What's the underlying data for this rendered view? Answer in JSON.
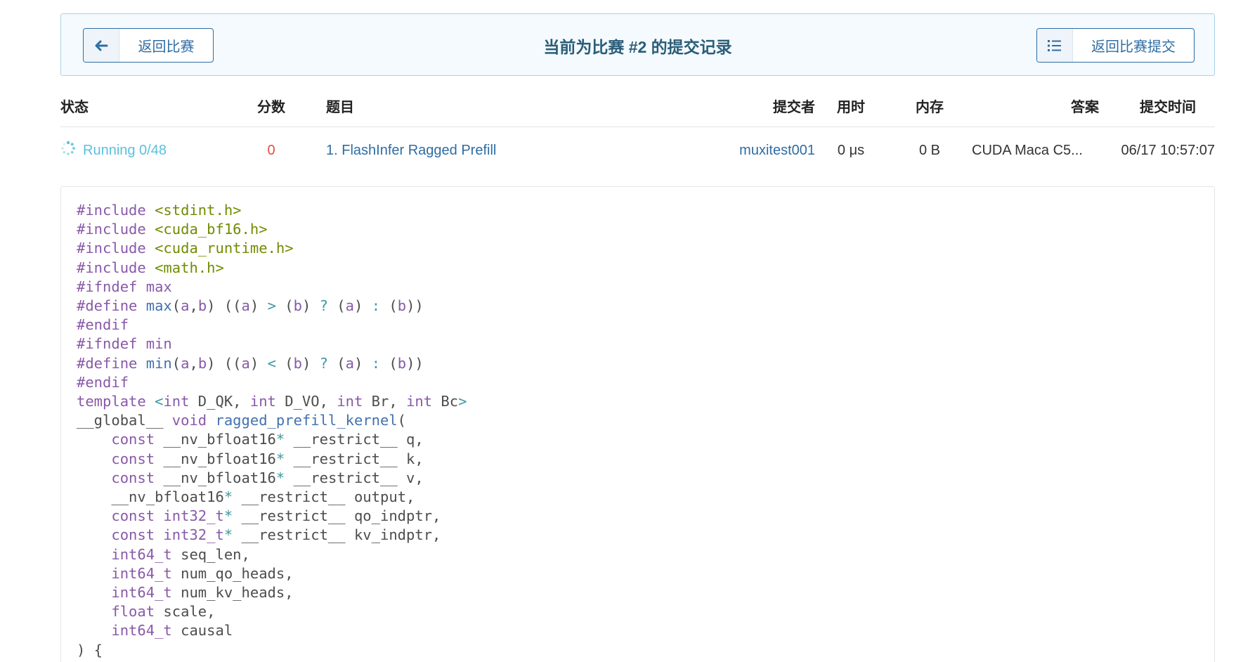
{
  "header": {
    "back_label": "返回比赛",
    "title": "当前为比赛 #2 的提交记录",
    "submissions_label": "返回比赛提交"
  },
  "table": {
    "columns": {
      "status": "状态",
      "score": "分数",
      "problem": "题目",
      "submitter": "提交者",
      "time": "用时",
      "memory": "内存",
      "answer": "答案",
      "submit_time": "提交时间"
    },
    "row": {
      "status": "Running 0/48",
      "score": "0",
      "problem": "1. FlashInfer Ragged Prefill",
      "submitter": "muxitest001",
      "time": "0 μs",
      "memory": "0 B",
      "answer": "CUDA Maca C5...",
      "submit_time": "06/17  10:57:07"
    }
  },
  "colors": {
    "accent": "#2e6da4",
    "running": "#5bc0de",
    "score": "#e74c3c",
    "title": "#2a5d78"
  },
  "icons": {
    "back": "arrow-left-icon",
    "list": "list-icon",
    "status": "spinner-icon"
  },
  "code": [
    [
      [
        "t-meta",
        "#include "
      ],
      [
        "t-str",
        "<stdint.h>"
      ]
    ],
    [
      [
        "t-meta",
        "#include "
      ],
      [
        "t-str",
        "<cuda_bf16.h>"
      ]
    ],
    [
      [
        "t-meta",
        "#include "
      ],
      [
        "t-str",
        "<cuda_runtime.h>"
      ]
    ],
    [
      [
        "t-meta",
        "#include "
      ],
      [
        "t-str",
        "<math.h>"
      ]
    ],
    [
      [
        "t-meta",
        "#ifndef max"
      ]
    ],
    [
      [
        "t-meta",
        "#define "
      ],
      [
        "t-fn",
        "max"
      ],
      [
        "t-plain",
        "("
      ],
      [
        "t-kw",
        "a"
      ],
      [
        "t-plain",
        ","
      ],
      [
        "t-kw",
        "b"
      ],
      [
        "t-plain",
        ") (("
      ],
      [
        "t-kw",
        "a"
      ],
      [
        "t-plain",
        ") "
      ],
      [
        "t-op",
        ">"
      ],
      [
        "t-plain",
        " ("
      ],
      [
        "t-kw",
        "b"
      ],
      [
        "t-plain",
        ") "
      ],
      [
        "t-op",
        "?"
      ],
      [
        "t-plain",
        " ("
      ],
      [
        "t-kw",
        "a"
      ],
      [
        "t-plain",
        ") "
      ],
      [
        "t-op",
        ":"
      ],
      [
        "t-plain",
        " ("
      ],
      [
        "t-kw",
        "b"
      ],
      [
        "t-plain",
        "))"
      ]
    ],
    [
      [
        "t-meta",
        "#endif"
      ]
    ],
    [
      [
        "t-meta",
        "#ifndef min"
      ]
    ],
    [
      [
        "t-meta",
        "#define "
      ],
      [
        "t-fn",
        "min"
      ],
      [
        "t-plain",
        "("
      ],
      [
        "t-kw",
        "a"
      ],
      [
        "t-plain",
        ","
      ],
      [
        "t-kw",
        "b"
      ],
      [
        "t-plain",
        ") (("
      ],
      [
        "t-kw",
        "a"
      ],
      [
        "t-plain",
        ") "
      ],
      [
        "t-op",
        "<"
      ],
      [
        "t-plain",
        " ("
      ],
      [
        "t-kw",
        "b"
      ],
      [
        "t-plain",
        ") "
      ],
      [
        "t-op",
        "?"
      ],
      [
        "t-plain",
        " ("
      ],
      [
        "t-kw",
        "a"
      ],
      [
        "t-plain",
        ") "
      ],
      [
        "t-op",
        ":"
      ],
      [
        "t-plain",
        " ("
      ],
      [
        "t-kw",
        "b"
      ],
      [
        "t-plain",
        "))"
      ]
    ],
    [
      [
        "t-meta",
        "#endif"
      ]
    ],
    [
      [
        "t-kw",
        "template "
      ],
      [
        "t-op",
        "<"
      ],
      [
        "t-kw",
        "int"
      ],
      [
        "t-plain",
        " D_QK, "
      ],
      [
        "t-kw",
        "int"
      ],
      [
        "t-plain",
        " D_VO, "
      ],
      [
        "t-kw",
        "int"
      ],
      [
        "t-plain",
        " Br, "
      ],
      [
        "t-kw",
        "int"
      ],
      [
        "t-plain",
        " Bc"
      ],
      [
        "t-op",
        ">"
      ]
    ],
    [
      [
        "t-plain",
        "__global__ "
      ],
      [
        "t-kw",
        "void "
      ],
      [
        "t-fn",
        "ragged_prefill_kernel"
      ],
      [
        "t-plain",
        "("
      ]
    ],
    [
      [
        "t-plain",
        "    "
      ],
      [
        "t-kw",
        "const"
      ],
      [
        "t-plain",
        " __nv_bfloat16"
      ],
      [
        "t-op",
        "*"
      ],
      [
        "t-plain",
        " __restrict__ q,"
      ]
    ],
    [
      [
        "t-plain",
        "    "
      ],
      [
        "t-kw",
        "const"
      ],
      [
        "t-plain",
        " __nv_bfloat16"
      ],
      [
        "t-op",
        "*"
      ],
      [
        "t-plain",
        " __restrict__ k,"
      ]
    ],
    [
      [
        "t-plain",
        "    "
      ],
      [
        "t-kw",
        "const"
      ],
      [
        "t-plain",
        " __nv_bfloat16"
      ],
      [
        "t-op",
        "*"
      ],
      [
        "t-plain",
        " __restrict__ v,"
      ]
    ],
    [
      [
        "t-plain",
        "    __nv_bfloat16"
      ],
      [
        "t-op",
        "*"
      ],
      [
        "t-plain",
        " __restrict__ output,"
      ]
    ],
    [
      [
        "t-plain",
        "    "
      ],
      [
        "t-kw",
        "const int32_t"
      ],
      [
        "t-op",
        "*"
      ],
      [
        "t-plain",
        " __restrict__ qo_indptr,"
      ]
    ],
    [
      [
        "t-plain",
        "    "
      ],
      [
        "t-kw",
        "const int32_t"
      ],
      [
        "t-op",
        "*"
      ],
      [
        "t-plain",
        " __restrict__ kv_indptr,"
      ]
    ],
    [
      [
        "t-plain",
        "    "
      ],
      [
        "t-kw",
        "int64_t"
      ],
      [
        "t-plain",
        " seq_len,"
      ]
    ],
    [
      [
        "t-plain",
        "    "
      ],
      [
        "t-kw",
        "int64_t"
      ],
      [
        "t-plain",
        " num_qo_heads,"
      ]
    ],
    [
      [
        "t-plain",
        "    "
      ],
      [
        "t-kw",
        "int64_t"
      ],
      [
        "t-plain",
        " num_kv_heads,"
      ]
    ],
    [
      [
        "t-plain",
        "    "
      ],
      [
        "t-kw",
        "float"
      ],
      [
        "t-plain",
        " scale,"
      ]
    ],
    [
      [
        "t-plain",
        "    "
      ],
      [
        "t-kw",
        "int64_t"
      ],
      [
        "t-plain",
        " causal"
      ]
    ],
    [
      [
        "t-plain",
        ") {"
      ]
    ]
  ]
}
